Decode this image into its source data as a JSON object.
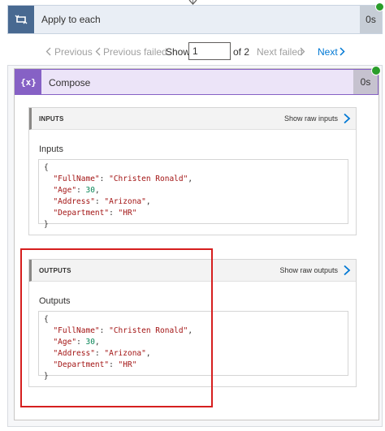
{
  "apply_to_each": {
    "title": "Apply to each",
    "duration": "0s"
  },
  "pager": {
    "previous": "Previous",
    "previous_failed": "Previous failed",
    "show_label": "Show",
    "current_page": "1",
    "of_label": "of 2",
    "next_failed": "Next failed",
    "next": "Next"
  },
  "compose": {
    "title": "Compose",
    "duration": "0s",
    "icon_text": "{x}"
  },
  "inputs_section": {
    "header": "INPUTS",
    "raw_link": "Show raw inputs",
    "sub_label": "Inputs",
    "open_brace": "{",
    "close_brace": "}",
    "lines": [
      {
        "key": "\"FullName\"",
        "sep": ": ",
        "value": "\"Christen Ronald\"",
        "tail": ",",
        "value_type": "string"
      },
      {
        "key": "\"Age\"",
        "sep": ": ",
        "value": "30",
        "tail": ",",
        "value_type": "number"
      },
      {
        "key": "\"Address\"",
        "sep": ": ",
        "value": "\"Arizona\"",
        "tail": ",",
        "value_type": "string"
      },
      {
        "key": "\"Department\"",
        "sep": ": ",
        "value": "\"HR\"",
        "tail": "",
        "value_type": "string"
      }
    ]
  },
  "outputs_section": {
    "header": "OUTPUTS",
    "raw_link": "Show raw outputs",
    "sub_label": "Outputs",
    "open_brace": "{",
    "close_brace": "}",
    "lines": [
      {
        "key": "\"FullName\"",
        "sep": ": ",
        "value": "\"Christen Ronald\"",
        "tail": ",",
        "value_type": "string"
      },
      {
        "key": "\"Age\"",
        "sep": ": ",
        "value": "30",
        "tail": ",",
        "value_type": "number"
      },
      {
        "key": "\"Address\"",
        "sep": ": ",
        "value": "\"Arizona\"",
        "tail": ",",
        "value_type": "string"
      },
      {
        "key": "\"Department\"",
        "sep": ": ",
        "value": "\"HR\"",
        "tail": "",
        "value_type": "string"
      }
    ]
  },
  "colors": {
    "loop_accent": "#486991",
    "compose_accent": "#8661c5",
    "link_blue": "#0078d4",
    "success_green": "#2a9d2a",
    "highlight_red": "#d61f1f",
    "json_key": "#a31515",
    "json_number": "#098658"
  },
  "icons": {
    "loop": "loop-icon",
    "compose": "compose-icon",
    "success": "check-circle-icon",
    "chevron_left": "chevron-left-icon",
    "chevron_right": "chevron-right-icon"
  }
}
